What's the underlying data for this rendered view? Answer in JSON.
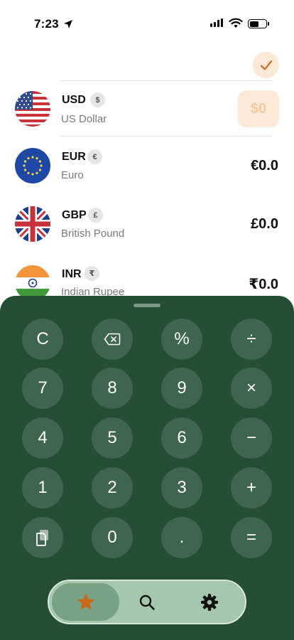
{
  "status_bar": {
    "time": "7:23"
  },
  "currencies": [
    {
      "code": "USD",
      "symbol": "$",
      "name": "US Dollar",
      "amount": "$0",
      "flag_icon": "us-flag-icon"
    },
    {
      "code": "EUR",
      "symbol": "€",
      "name": "Euro",
      "amount": "€0.0",
      "flag_icon": "eu-flag-icon"
    },
    {
      "code": "GBP",
      "symbol": "£",
      "name": "British Pound",
      "amount": "£0.0",
      "flag_icon": "uk-flag-icon"
    },
    {
      "code": "INR",
      "symbol": "₹",
      "name": "Indian Rupee",
      "amount": "₹0.0",
      "flag_icon": "india-flag-icon"
    }
  ],
  "keypad": {
    "rows": [
      [
        "C",
        "⌫",
        "%",
        "÷"
      ],
      [
        "7",
        "8",
        "9",
        "×"
      ],
      [
        "4",
        "5",
        "6",
        "−"
      ],
      [
        "1",
        "2",
        "3",
        "+"
      ],
      [
        "paste",
        "0",
        ".",
        "="
      ]
    ],
    "clear": "C",
    "percent": "%",
    "divide": "÷",
    "seven": "7",
    "eight": "8",
    "nine": "9",
    "multiply": "×",
    "four": "4",
    "five": "5",
    "six": "6",
    "minus": "−",
    "one": "1",
    "two": "2",
    "three": "3",
    "plus": "+",
    "zero": "0",
    "decimal": ".",
    "equals": "="
  },
  "tab_bar": {
    "tabs": [
      {
        "icon": "star-icon",
        "active": true
      },
      {
        "icon": "search-icon",
        "active": false
      },
      {
        "icon": "gear-icon",
        "active": false
      }
    ]
  },
  "colors": {
    "accent": "#c96a1a",
    "accent_light": "#fbe8d6",
    "keypad_bg": "#264e37",
    "key_bg": "#3f6450",
    "tab_bar_bg": "#a5c7b0"
  }
}
